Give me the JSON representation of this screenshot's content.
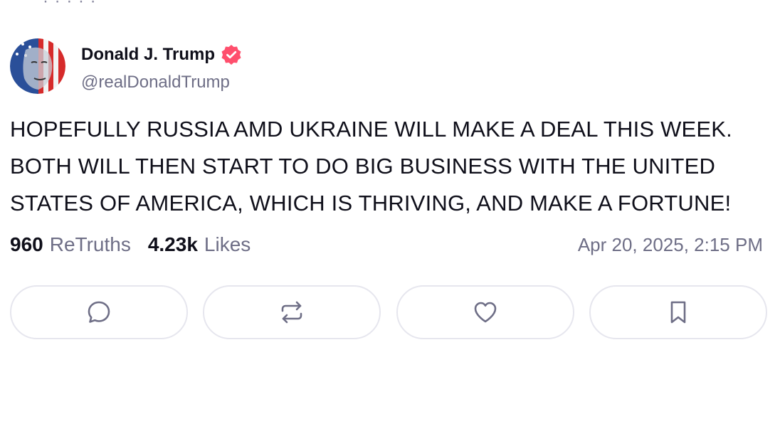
{
  "post": {
    "author": {
      "display_name": "Donald J. Trump",
      "handle": "@realDonaldTrump",
      "verified": true,
      "verified_color": "#ff4f6d"
    },
    "text": "HOPEFULLY RUSSIA AMD UKRAINE WILL MAKE A DEAL THIS WEEK. BOTH WILL THEN START TO DO BIG BUSINESS WITH THE UNITED STATES OF AMERICA, WHICH IS THRIVING, AND MAKE A FORTUNE!",
    "stats": {
      "retruths_count": "960",
      "retruths_label": "ReTruths",
      "likes_count": "4.23k",
      "likes_label": "Likes"
    },
    "timestamp": "Apr 20, 2025, 2:15 PM"
  },
  "actions": [
    {
      "name": "reply",
      "icon": "comment-bubble-icon"
    },
    {
      "name": "retruth",
      "icon": "repost-arrows-icon"
    },
    {
      "name": "like",
      "icon": "heart-icon"
    },
    {
      "name": "bookmark",
      "icon": "bookmark-icon"
    }
  ],
  "colors": {
    "icon_stroke": "#6e6e86",
    "button_border": "#e6e6ee"
  }
}
